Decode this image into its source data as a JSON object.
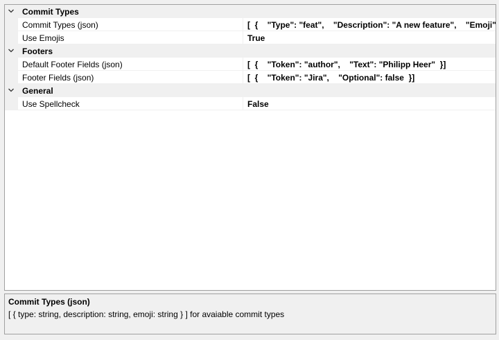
{
  "property_grid": {
    "categories": [
      {
        "label": "Commit Types",
        "properties": [
          {
            "name": "Commit Types (json)",
            "value": "[  {    \"Type\": \"feat\",    \"Description\": \"A new feature\",    \"Emoji\": \":sparkles:\"  }]"
          },
          {
            "name": "Use Emojis",
            "value": "True"
          }
        ]
      },
      {
        "label": "Footers",
        "properties": [
          {
            "name": "Default Footer Fields (json)",
            "value": "[  {    \"Token\": \"author\",    \"Text\": \"Philipp Heer\"  }]"
          },
          {
            "name": "Footer Fields (json)",
            "value": "[  {    \"Token\": \"Jira\",    \"Optional\": false  }]"
          }
        ]
      },
      {
        "label": "General",
        "properties": [
          {
            "name": "Use Spellcheck",
            "value": "False"
          }
        ]
      }
    ]
  },
  "description_panel": {
    "title": "Commit Types (json)",
    "text": "[ { type: string, description: string, emoji: string } ] for avaiable commit types"
  },
  "colors": {
    "background": "#f0f0f0",
    "grid_background": "#ffffff",
    "border": "#a0a0a0",
    "chevron": "#333333"
  },
  "icons": {
    "expand_toggle": "chevron-down-icon"
  }
}
